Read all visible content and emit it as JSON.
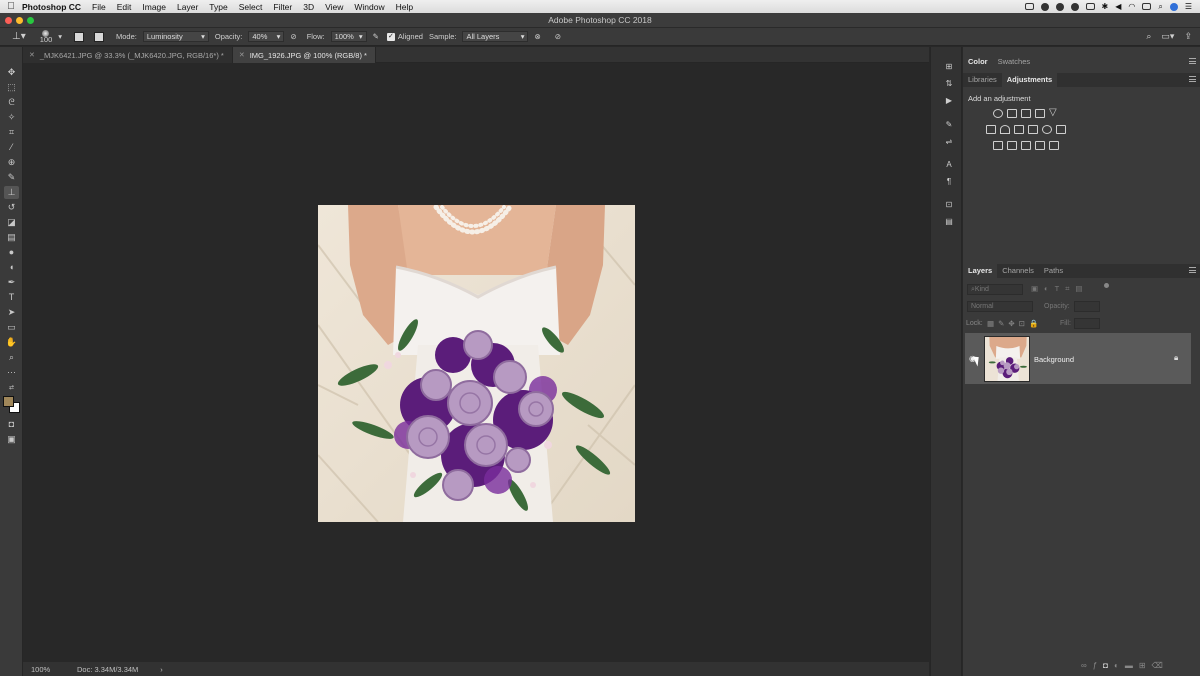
{
  "menubar": {
    "app_name": "Photoshop CC",
    "items": [
      "File",
      "Edit",
      "Image",
      "Layer",
      "Type",
      "Select",
      "Filter",
      "3D",
      "View",
      "Window",
      "Help"
    ]
  },
  "window": {
    "title": "Adobe Photoshop CC 2018"
  },
  "options_bar": {
    "brush_size": "100",
    "mode_label": "Mode:",
    "mode_value": "Luminosity",
    "opacity_label": "Opacity:",
    "opacity_value": "40%",
    "flow_label": "Flow:",
    "flow_value": "100%",
    "aligned_label": "Aligned",
    "aligned_checked": true,
    "sample_label": "Sample:",
    "sample_value": "All Layers"
  },
  "tabs": [
    {
      "label": "_MJK6421.JPG @ 33.3% (_MJK6420.JPG, RGB/16*) *",
      "active": false
    },
    {
      "label": "IMG_1926.JPG @ 100% (RGB/8) *",
      "active": true
    }
  ],
  "status": {
    "zoom": "100%",
    "doc": "Doc: 3.34M/3.34M",
    "arrow": "›"
  },
  "color_panel": {
    "tabs": [
      "Color",
      "Swatches"
    ]
  },
  "adjust_panel": {
    "tabs": [
      "Libraries",
      "Adjustments"
    ],
    "heading": "Add an adjustment"
  },
  "layers_panel": {
    "tabs": [
      "Layers",
      "Channels",
      "Paths"
    ],
    "kind_placeholder": "Kind",
    "blend_mode": "Normal",
    "opacity_label": "Opacity:",
    "lock_label": "Lock:",
    "fill_label": "Fill:",
    "layers": [
      {
        "name": "Background",
        "visible": true,
        "locked": true
      }
    ]
  },
  "colors": {
    "foreground": "#a0875a",
    "background": "#ffffff",
    "accent": "#2f6fd8"
  }
}
